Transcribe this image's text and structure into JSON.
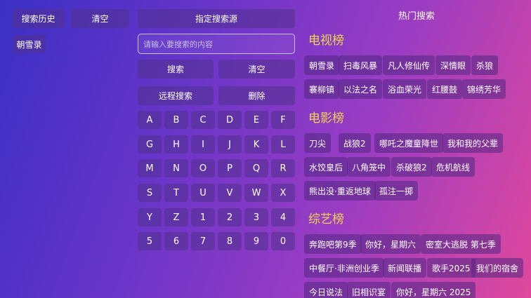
{
  "history": {
    "title": "搜索历史",
    "clear_label": "清空",
    "items": [
      "朝雪录"
    ]
  },
  "search": {
    "source_label": "指定搜索源",
    "placeholder": "请输入要搜索的内容",
    "search_label": "搜索",
    "clear_label": "清空",
    "remote_label": "远程搜索",
    "delete_label": "删除"
  },
  "keyboard": {
    "keys": [
      "A",
      "B",
      "C",
      "D",
      "E",
      "F",
      "G",
      "H",
      "I",
      "J",
      "K",
      "L",
      "M",
      "N",
      "O",
      "P",
      "Q",
      "R",
      "S",
      "T",
      "U",
      "V",
      "W",
      "X",
      "Y",
      "Z",
      "1",
      "2",
      "3",
      "4",
      "5",
      "6",
      "7",
      "8",
      "9",
      "0"
    ]
  },
  "hot": {
    "title": "热门搜索",
    "sections": [
      {
        "title": "电视榜",
        "items": [
          "朝雪录",
          "扫毒风暴",
          "凡人修仙传",
          "深情眼",
          "杀狼",
          "褰柳镇",
          "以法之名",
          "浴血荣光",
          "红腰鼓",
          "锦绣芳华"
        ]
      },
      {
        "title": "电影榜",
        "items": [
          "刀尖",
          "战狼2",
          "哪吒之魔童降世",
          "我和我的父辈",
          "水饺皇后",
          "八角笼中",
          "杀破狼2",
          "危机航线",
          "熊出没·重返地球",
          "孤注一掷"
        ]
      },
      {
        "title": "综艺榜",
        "items": [
          "奔跑吧第9季",
          "你好，星期六",
          "密室大逃脱 第七季",
          "中餐厅·非洲创业季",
          "新闻联播",
          "歌手2025",
          "我们的宿舍",
          "今日说法",
          "旧相识宴",
          "你好，星期六 2025"
        ]
      }
    ]
  },
  "colors": {
    "accent_yellow": "#f2d54a",
    "button_bg": "#50328c"
  }
}
